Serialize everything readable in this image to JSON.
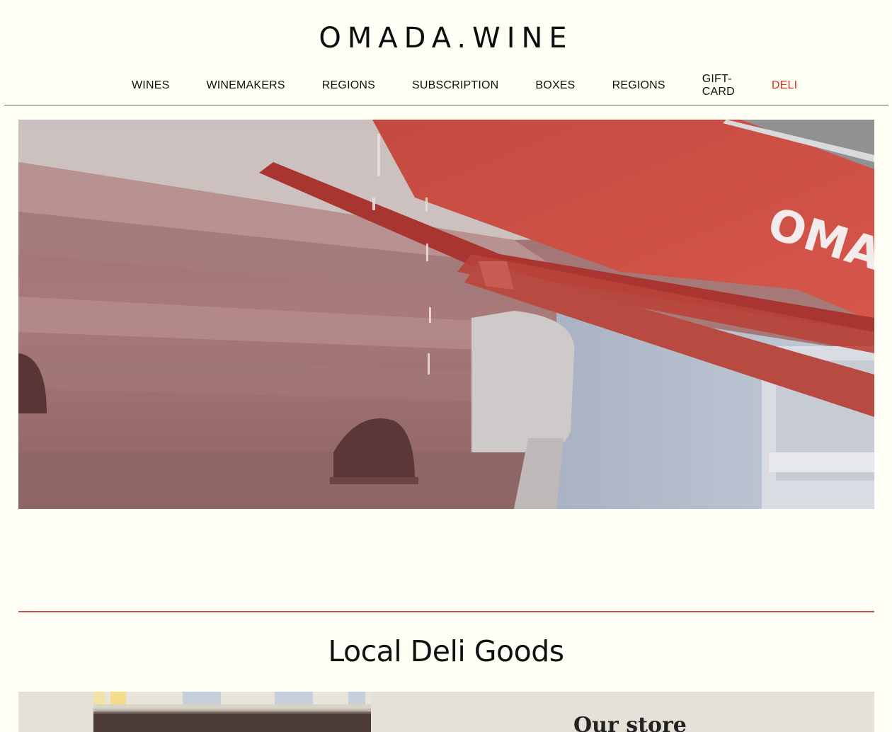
{
  "header": {
    "logo": "OMADA.WINE"
  },
  "nav": {
    "items": [
      {
        "label": "WINES"
      },
      {
        "label": "WINEMAKERS"
      },
      {
        "label": "REGIONS"
      },
      {
        "label": "SUBSCRIPTION"
      },
      {
        "label": "BOXES"
      },
      {
        "label": "REGIONS"
      },
      {
        "label": "GIFT-CARD"
      },
      {
        "label": "DELI",
        "active": true
      }
    ],
    "active_color": "#e52b1b"
  },
  "hero": {
    "awning_text": "OMADA",
    "awning_color": "#d0473c"
  },
  "section": {
    "title": "Local Deli Goods",
    "rule_color": "#c0504a"
  },
  "store": {
    "heading": "Our store"
  }
}
